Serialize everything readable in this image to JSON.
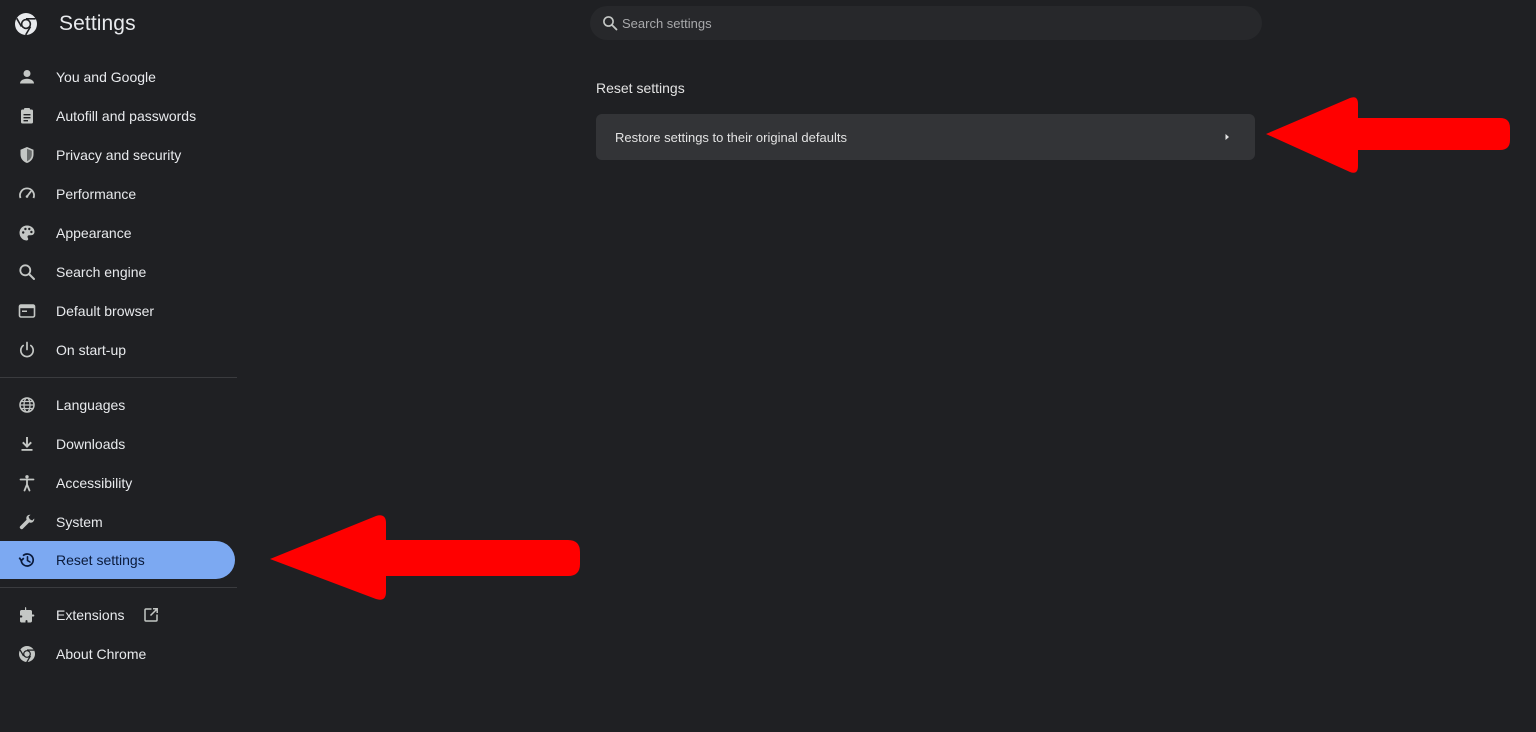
{
  "header": {
    "title": "Settings",
    "logo_icon": "chrome-logo-icon"
  },
  "search": {
    "placeholder": "Search settings",
    "value": ""
  },
  "sidebar": {
    "items": [
      {
        "label": "You and Google",
        "icon": "person-icon"
      },
      {
        "label": "Autofill and passwords",
        "icon": "clipboard-icon"
      },
      {
        "label": "Privacy and security",
        "icon": "shield-icon"
      },
      {
        "label": "Performance",
        "icon": "speedometer-icon"
      },
      {
        "label": "Appearance",
        "icon": "palette-icon"
      },
      {
        "label": "Search engine",
        "icon": "search-icon"
      },
      {
        "label": "Default browser",
        "icon": "browser-window-icon"
      },
      {
        "label": "On start-up",
        "icon": "power-icon"
      },
      {
        "label": "Languages",
        "icon": "globe-icon"
      },
      {
        "label": "Downloads",
        "icon": "download-icon"
      },
      {
        "label": "Accessibility",
        "icon": "accessibility-icon"
      },
      {
        "label": "System",
        "icon": "wrench-icon"
      },
      {
        "label": "Reset settings",
        "icon": "history-icon",
        "active": true
      },
      {
        "label": "Extensions",
        "icon": "puzzle-icon"
      },
      {
        "label": "About Chrome",
        "icon": "chrome-logo-icon"
      }
    ]
  },
  "main": {
    "section_title": "Reset settings",
    "restore_row": {
      "label": "Restore settings to their original defaults"
    }
  },
  "colors": {
    "background": "#1f2023",
    "active_item": "#7ca9f2",
    "card": "#333437",
    "annotation_arrow": "#ff0000"
  }
}
